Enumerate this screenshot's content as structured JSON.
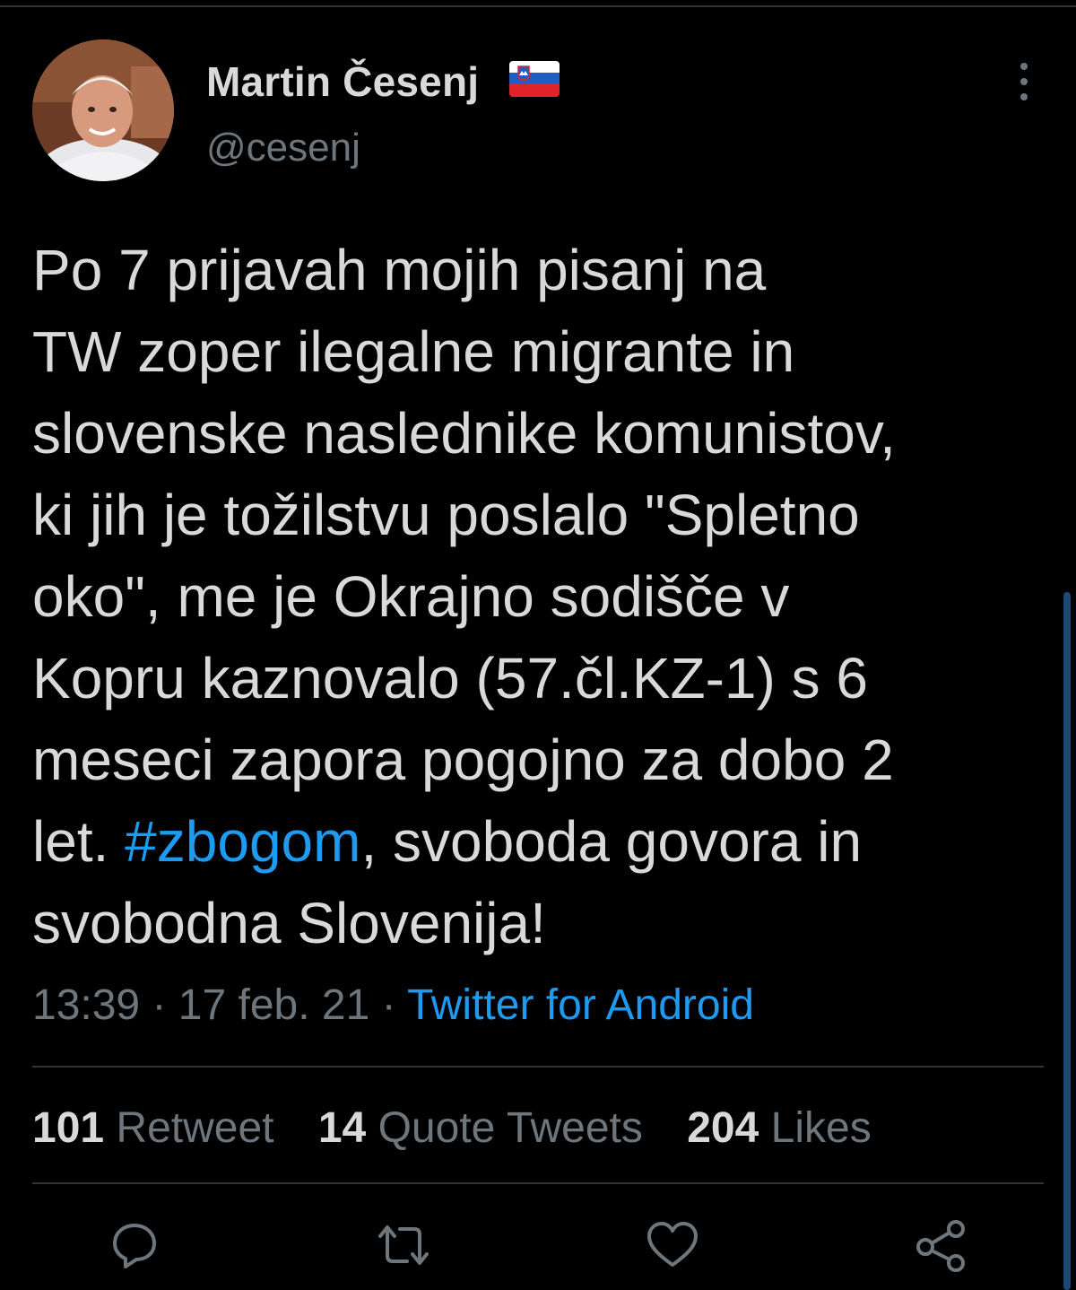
{
  "user": {
    "display_name": "Martin Česenj",
    "handle": "@cesenj",
    "flag_icon": "slovenia-flag-icon"
  },
  "tweet": {
    "lines": [
      "Po 7 prijavah mojih pisanj na",
      "TW zoper ilegalne migrante in",
      "slovenske naslednike komunistov,",
      "ki jih je tožilstvu poslalo \"Spletno",
      "oko\", me je Okrajno sodišče v",
      "Kopru kaznovalo (57.čl.KZ-1) s 6",
      "meseci zapora pogojno za dobo 2"
    ],
    "line8_pre": "let. ",
    "hashtag": "#zbogom",
    "line8_post": ", svoboda govora in",
    "line9": "svobodna Slovenija!"
  },
  "meta": {
    "time": "13:39",
    "sep1": " · ",
    "date": "17 feb. 21",
    "sep2": " · ",
    "source": "Twitter for Android"
  },
  "stats": {
    "retweets_count": "101",
    "retweets_label": " Retweet",
    "quotes_count": "14",
    "quotes_label": " Quote Tweets",
    "likes_count": "204",
    "likes_label": " Likes"
  },
  "colors": {
    "background": "#000000",
    "text": "#d9d9d9",
    "muted": "#6e767d",
    "accent": "#1d9bf0",
    "divider": "#2f3336"
  },
  "icons": [
    "more-vertical-icon",
    "reply-icon",
    "retweet-icon",
    "like-icon",
    "share-icon"
  ]
}
